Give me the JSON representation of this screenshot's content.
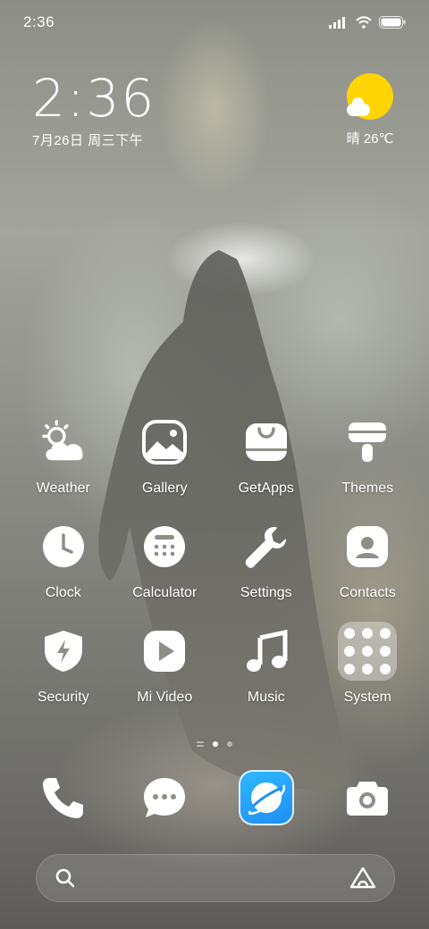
{
  "status_bar": {
    "time": "2:36",
    "signal_icon": "signal-bars-icon",
    "wifi_icon": "wifi-icon",
    "battery_icon": "battery-icon"
  },
  "clock_widget": {
    "time": "2:36",
    "date": "7月26日 周三下午"
  },
  "weather_widget": {
    "icon": "sun-cloud-icon",
    "condition_temp": "晴 26℃",
    "sun_color": "#ffd400"
  },
  "apps": [
    {
      "label": "Weather",
      "icon": "weather-icon"
    },
    {
      "label": "Gallery",
      "icon": "gallery-icon"
    },
    {
      "label": "GetApps",
      "icon": "getapps-icon"
    },
    {
      "label": "Themes",
      "icon": "themes-icon"
    },
    {
      "label": "Clock",
      "icon": "clock-icon"
    },
    {
      "label": "Calculator",
      "icon": "calculator-icon"
    },
    {
      "label": "Settings",
      "icon": "wrench-icon"
    },
    {
      "label": "Contacts",
      "icon": "contacts-icon"
    },
    {
      "label": "Security",
      "icon": "shield-icon"
    },
    {
      "label": "Mi Video",
      "icon": "play-icon"
    },
    {
      "label": "Music",
      "icon": "music-note-icon"
    },
    {
      "label": "System",
      "icon": "folder-icon"
    }
  ],
  "page_indicator": {
    "pages": 2,
    "active_page": 1
  },
  "dock": [
    {
      "icon": "phone-icon"
    },
    {
      "icon": "message-icon"
    },
    {
      "icon": "browser-icon",
      "color": "#1f8ef5"
    },
    {
      "icon": "camera-icon"
    }
  ],
  "search_bar": {
    "left_icon": "search-icon",
    "right_icon": "assistant-icon"
  }
}
